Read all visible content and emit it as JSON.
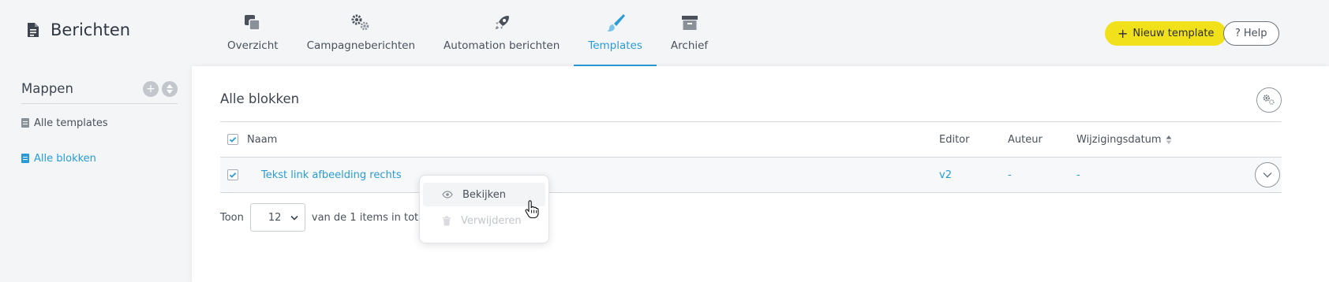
{
  "header": {
    "app_title": "Berichten",
    "nav": [
      {
        "label": "Overzicht",
        "icon": "overview-icon"
      },
      {
        "label": "Campagneberichten",
        "icon": "gears-icon"
      },
      {
        "label": "Automation berichten",
        "icon": "rocket-icon"
      },
      {
        "label": "Templates",
        "icon": "brush-icon",
        "active": true
      },
      {
        "label": "Archief",
        "icon": "archive-icon"
      }
    ],
    "new_template_label": "Nieuw template",
    "help_label": "Help"
  },
  "sidebar": {
    "title": "Mappen",
    "items": [
      {
        "label": "Alle templates",
        "active": false
      },
      {
        "label": "Alle blokken",
        "active": true
      }
    ]
  },
  "main": {
    "title": "Alle blokken",
    "table": {
      "columns": [
        "Naam",
        "Editor",
        "Auteur",
        "Wijzigingsdatum"
      ],
      "rows": [
        {
          "name": "Tekst link afbeelding rechts",
          "editor": "v2",
          "author": "-",
          "modified": "-"
        }
      ]
    },
    "pager": {
      "prefix": "Toon",
      "page_size": "12",
      "suffix": "van de 1 items in totaal."
    }
  },
  "context_menu": {
    "items": [
      {
        "label": "Bekijken",
        "icon": "eye-icon",
        "disabled": false
      },
      {
        "label": "Verwijderen",
        "icon": "trash-icon",
        "disabled": true
      }
    ]
  },
  "colors": {
    "accent": "#2a9bd6",
    "primary_button": "#f0e11a",
    "background": "#f4f5f7"
  }
}
